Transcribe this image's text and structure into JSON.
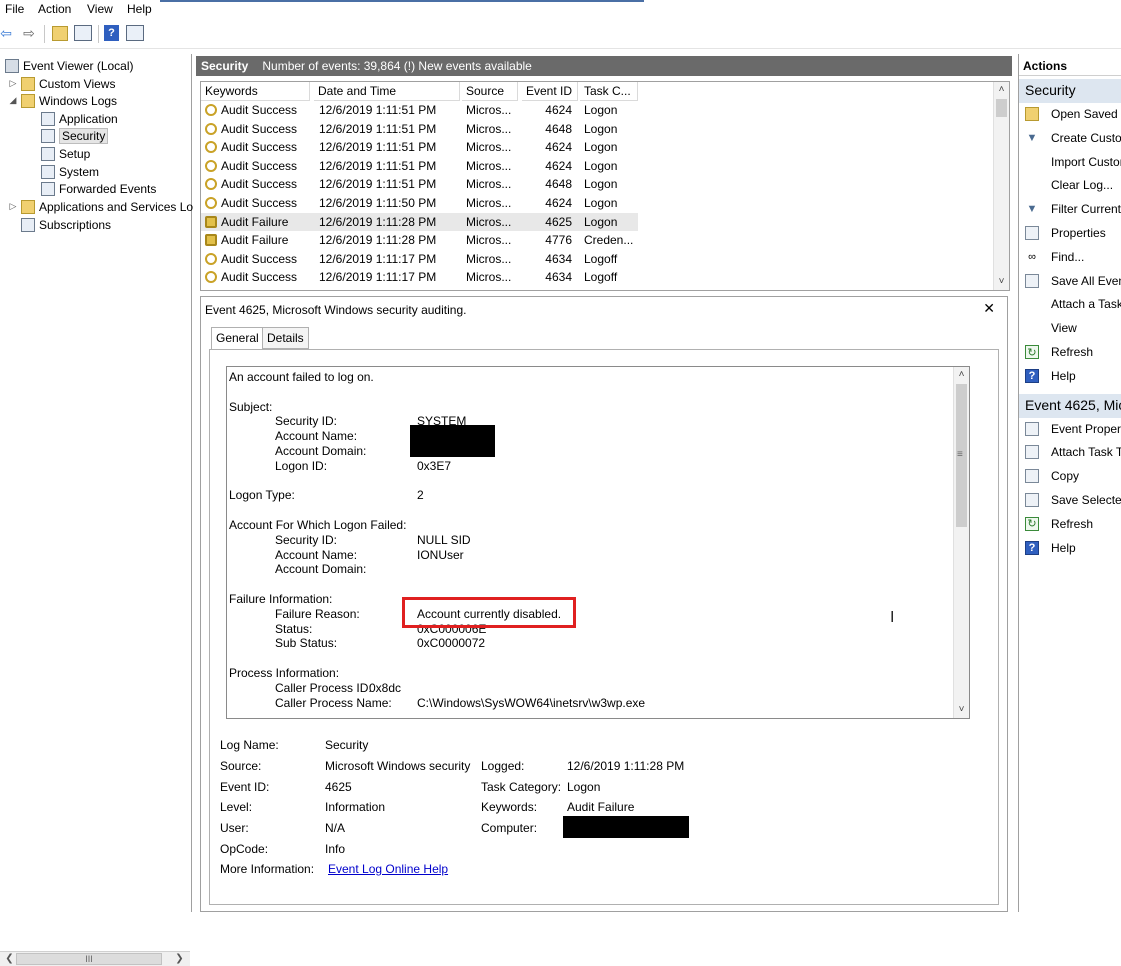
{
  "menu": {
    "items": [
      "File",
      "Action",
      "View",
      "Help"
    ]
  },
  "tree": {
    "items": [
      {
        "label": "Event Viewer (Local)",
        "level": 0,
        "expander": "",
        "icon": "event-viewer-icon"
      },
      {
        "label": "Custom Views",
        "level": 1,
        "expander": "▷",
        "icon": "folder-icon"
      },
      {
        "label": "Windows Logs",
        "level": 1,
        "expander": "◢",
        "icon": "folder-icon"
      },
      {
        "label": "Application",
        "level": 2,
        "expander": "",
        "icon": "log-icon"
      },
      {
        "label": "Security",
        "level": 2,
        "expander": "",
        "icon": "log-icon",
        "selected": true
      },
      {
        "label": "Setup",
        "level": 2,
        "expander": "",
        "icon": "log-icon"
      },
      {
        "label": "System",
        "level": 2,
        "expander": "",
        "icon": "log-icon"
      },
      {
        "label": "Forwarded Events",
        "level": 2,
        "expander": "",
        "icon": "log-icon"
      },
      {
        "label": "Applications and Services Lo",
        "level": 1,
        "expander": "▷",
        "icon": "folder-icon"
      },
      {
        "label": "Subscriptions",
        "level": 1,
        "expander": "",
        "icon": "subscriptions-icon"
      }
    ]
  },
  "center_header": {
    "title": "Security",
    "info": "Number of events: 39,864 (!) New events available"
  },
  "events_table": {
    "columns": [
      "Keywords",
      "Date and Time",
      "Source",
      "Event ID",
      "Task C..."
    ],
    "rows": [
      {
        "keyword": "Audit Success",
        "datetime": "12/6/2019 1:11:51 PM",
        "source": "Micros...",
        "event_id": "4624",
        "task": "Logon",
        "type": "success"
      },
      {
        "keyword": "Audit Success",
        "datetime": "12/6/2019 1:11:51 PM",
        "source": "Micros...",
        "event_id": "4648",
        "task": "Logon",
        "type": "success"
      },
      {
        "keyword": "Audit Success",
        "datetime": "12/6/2019 1:11:51 PM",
        "source": "Micros...",
        "event_id": "4624",
        "task": "Logon",
        "type": "success"
      },
      {
        "keyword": "Audit Success",
        "datetime": "12/6/2019 1:11:51 PM",
        "source": "Micros...",
        "event_id": "4624",
        "task": "Logon",
        "type": "success"
      },
      {
        "keyword": "Audit Success",
        "datetime": "12/6/2019 1:11:51 PM",
        "source": "Micros...",
        "event_id": "4648",
        "task": "Logon",
        "type": "success"
      },
      {
        "keyword": "Audit Success",
        "datetime": "12/6/2019 1:11:50 PM",
        "source": "Micros...",
        "event_id": "4624",
        "task": "Logon",
        "type": "success"
      },
      {
        "keyword": "Audit Failure",
        "datetime": "12/6/2019 1:11:28 PM",
        "source": "Micros...",
        "event_id": "4625",
        "task": "Logon",
        "type": "failure",
        "selected": true
      },
      {
        "keyword": "Audit Failure",
        "datetime": "12/6/2019 1:11:28 PM",
        "source": "Micros...",
        "event_id": "4776",
        "task": "Creden...",
        "type": "failure"
      },
      {
        "keyword": "Audit Success",
        "datetime": "12/6/2019 1:11:17 PM",
        "source": "Micros...",
        "event_id": "4634",
        "task": "Logoff",
        "type": "success"
      },
      {
        "keyword": "Audit Success",
        "datetime": "12/6/2019 1:11:17 PM",
        "source": "Micros...",
        "event_id": "4634",
        "task": "Logoff",
        "type": "success"
      }
    ]
  },
  "detail": {
    "title": "Event 4625, Microsoft Windows security auditing.",
    "tabs": [
      "General",
      "Details"
    ],
    "message_lines": [
      {
        "label": "An account failed to log on.",
        "value": "",
        "indent": 0,
        "gap": 0
      },
      {
        "label": "Subject:",
        "value": "",
        "indent": 0,
        "gap": 1
      },
      {
        "label": "Security ID:",
        "value": "SYSTEM",
        "indent": 1,
        "gap": 0
      },
      {
        "label": "Account Name:",
        "value": "",
        "indent": 1,
        "gap": 0
      },
      {
        "label": "Account Domain:",
        "value": "",
        "indent": 1,
        "gap": 0
      },
      {
        "label": "Logon ID:",
        "value": "0x3E7",
        "indent": 1,
        "gap": 0
      },
      {
        "label": "Logon Type:",
        "value": "2",
        "indent": 0,
        "gap": 1
      },
      {
        "label": "Account For Which Logon Failed:",
        "value": "",
        "indent": 0,
        "gap": 1
      },
      {
        "label": "Security ID:",
        "value": "NULL SID",
        "indent": 1,
        "gap": 0
      },
      {
        "label": "Account Name:",
        "value": "IONUser",
        "indent": 1,
        "gap": 0
      },
      {
        "label": "Account Domain:",
        "value": "",
        "indent": 1,
        "gap": 0
      },
      {
        "label": "Failure Information:",
        "value": "",
        "indent": 0,
        "gap": 1
      },
      {
        "label": "Failure Reason:",
        "value": "Account currently disabled.",
        "indent": 1,
        "gap": 0
      },
      {
        "label": "Status:",
        "value": "0xC000006E",
        "indent": 1,
        "gap": 0
      },
      {
        "label": "Sub Status:",
        "value": "0xC0000072",
        "indent": 1,
        "gap": 0
      },
      {
        "label": "Process Information:",
        "value": "",
        "indent": 0,
        "gap": 1
      },
      {
        "label": "Caller Process ID:",
        "value": "0x8dc",
        "indent": 1,
        "gap": 0,
        "inline": true
      },
      {
        "label": "Caller Process Name:",
        "value": "C:\\Windows\\SysWOW64\\inetsrv\\w3wp.exe",
        "indent": 1,
        "gap": 0
      }
    ],
    "properties": {
      "log_name_label": "Log Name:",
      "log_name": "Security",
      "source_label": "Source:",
      "source": "Microsoft Windows security",
      "logged_label": "Logged:",
      "logged": "12/6/2019 1:11:28 PM",
      "event_id_label": "Event ID:",
      "event_id": "4625",
      "task_category_label": "Task Category:",
      "task_category": "Logon",
      "level_label": "Level:",
      "level": "Information",
      "keywords_label": "Keywords:",
      "keywords": "Audit Failure",
      "user_label": "User:",
      "user": "N/A",
      "computer_label": "Computer:",
      "opcode_label": "OpCode:",
      "opcode": "Info",
      "more_info_label": "More Information:",
      "more_info_link": "Event Log Online Help"
    }
  },
  "actions": {
    "header": "Actions",
    "sections": [
      {
        "title": "Security",
        "items": [
          {
            "label": "Open Saved Lo",
            "icon": "open-folder-icon"
          },
          {
            "label": "Create Custom",
            "icon": "filter-icon"
          },
          {
            "label": "Import Custom",
            "icon": ""
          },
          {
            "label": "Clear Log...",
            "icon": ""
          },
          {
            "label": "Filter Current L",
            "icon": "filter-icon"
          },
          {
            "label": "Properties",
            "icon": "properties-icon"
          },
          {
            "label": "Find...",
            "icon": "binoculars-icon"
          },
          {
            "label": "Save All Event",
            "icon": "save-icon"
          },
          {
            "label": "Attach a Task",
            "icon": ""
          },
          {
            "label": "View",
            "icon": ""
          },
          {
            "label": "Refresh",
            "icon": "refresh-icon"
          },
          {
            "label": "Help",
            "icon": "help-icon"
          }
        ]
      },
      {
        "title": "Event 4625, Mic",
        "items": [
          {
            "label": "Event Properti",
            "icon": "properties-icon"
          },
          {
            "label": "Attach Task To",
            "icon": "task-icon"
          },
          {
            "label": "Copy",
            "icon": "copy-icon"
          },
          {
            "label": "Save Selected",
            "icon": "save-icon"
          },
          {
            "label": "Refresh",
            "icon": "refresh-icon"
          },
          {
            "label": "Help",
            "icon": "help-icon"
          }
        ]
      }
    ]
  },
  "colors": {
    "header_bar": "#6a6a6a",
    "selection": "#e8e8e8",
    "highlight_box": "#e02020",
    "action_section": "#dde6f0",
    "link": "#0000cc"
  }
}
